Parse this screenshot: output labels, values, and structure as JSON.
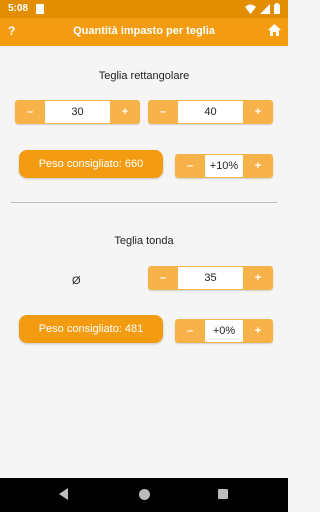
{
  "status_bar": {
    "time": "5:08",
    "icons": [
      "sd-card-icon",
      "wifi-icon",
      "signal-icon",
      "battery-icon"
    ]
  },
  "app_bar": {
    "help": "?",
    "title": "Quantità impasto per teglia",
    "home_icon": "home-icon"
  },
  "rect": {
    "title": "Teglia rettangolare",
    "width": {
      "minus": "–",
      "value": "30",
      "plus": "+"
    },
    "height": {
      "minus": "–",
      "value": "40",
      "plus": "+"
    },
    "weight_label": "Peso consigliato: 660",
    "adjust": {
      "minus": "–",
      "value": "+10%",
      "plus": "+"
    }
  },
  "round": {
    "title": "Teglia tonda",
    "diameter_symbol": "Ø",
    "diameter": {
      "minus": "–",
      "value": "35",
      "plus": "+"
    },
    "weight_label": "Peso consigliato: 481",
    "adjust": {
      "minus": "–",
      "value": "+0%",
      "plus": "+"
    }
  },
  "colors": {
    "status_bar": "#e28e00",
    "app_bar": "#f39c12",
    "button": "#f7b34a",
    "background": "#f5f5f5"
  }
}
